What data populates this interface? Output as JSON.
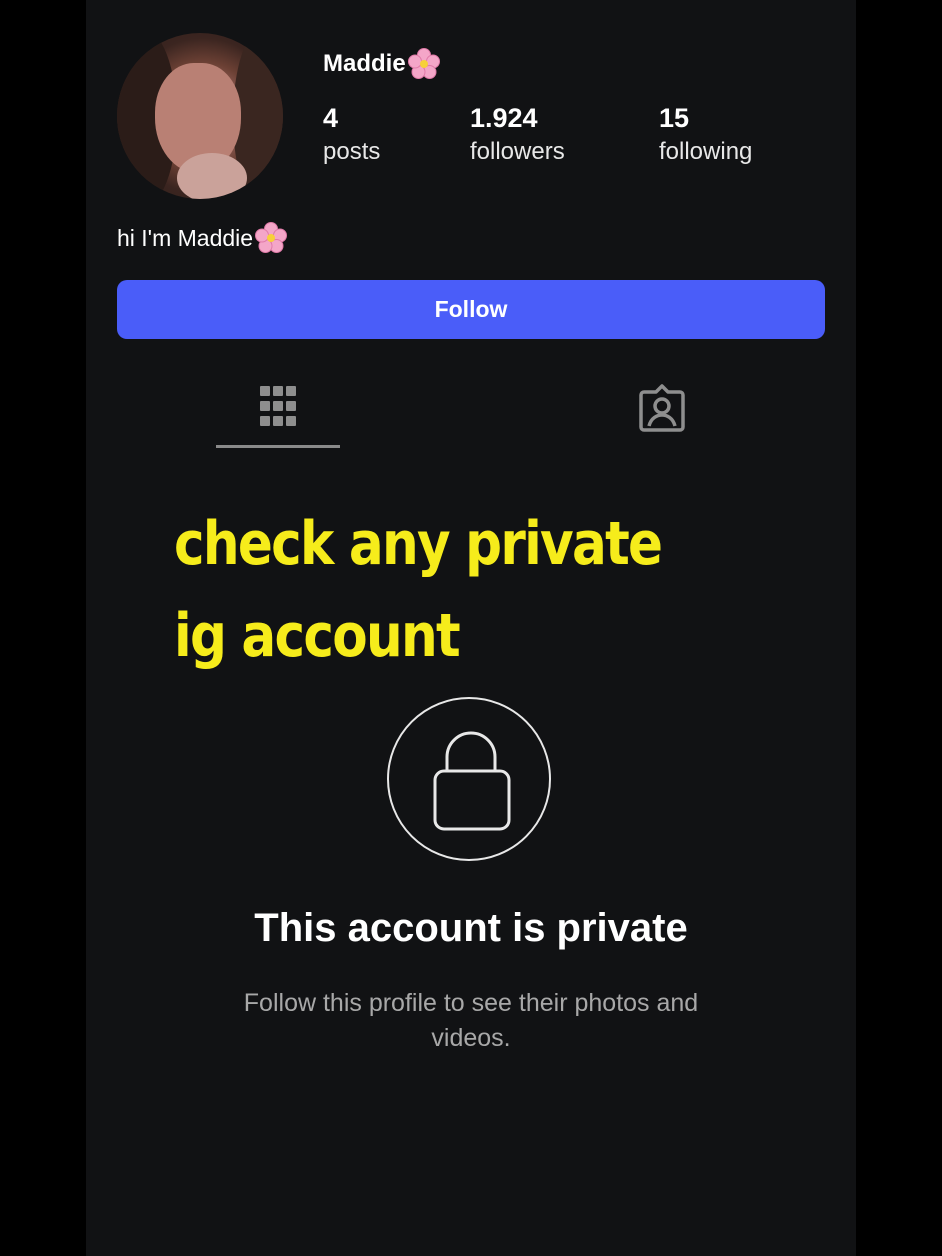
{
  "profile": {
    "username": "Maddie",
    "bio": "hi I'm Maddie"
  },
  "stats": {
    "posts": {
      "value": "4",
      "label": "posts"
    },
    "followers": {
      "value": "1.924",
      "label": "followers"
    },
    "following": {
      "value": "15",
      "label": "following"
    }
  },
  "actions": {
    "follow_label": "Follow"
  },
  "tabs": [
    {
      "icon": "grid-icon",
      "active": true
    },
    {
      "icon": "tagged-person-icon",
      "active": false
    }
  ],
  "overlay": {
    "line1": "check any private",
    "line2": "ig account",
    "color": "#f6ec1b"
  },
  "private_notice": {
    "icon": "lock-icon",
    "title": "This account is private",
    "subtitle": "Follow this profile to see their photos and videos."
  },
  "colors": {
    "accent": "#4a5df9",
    "background": "#111214"
  }
}
